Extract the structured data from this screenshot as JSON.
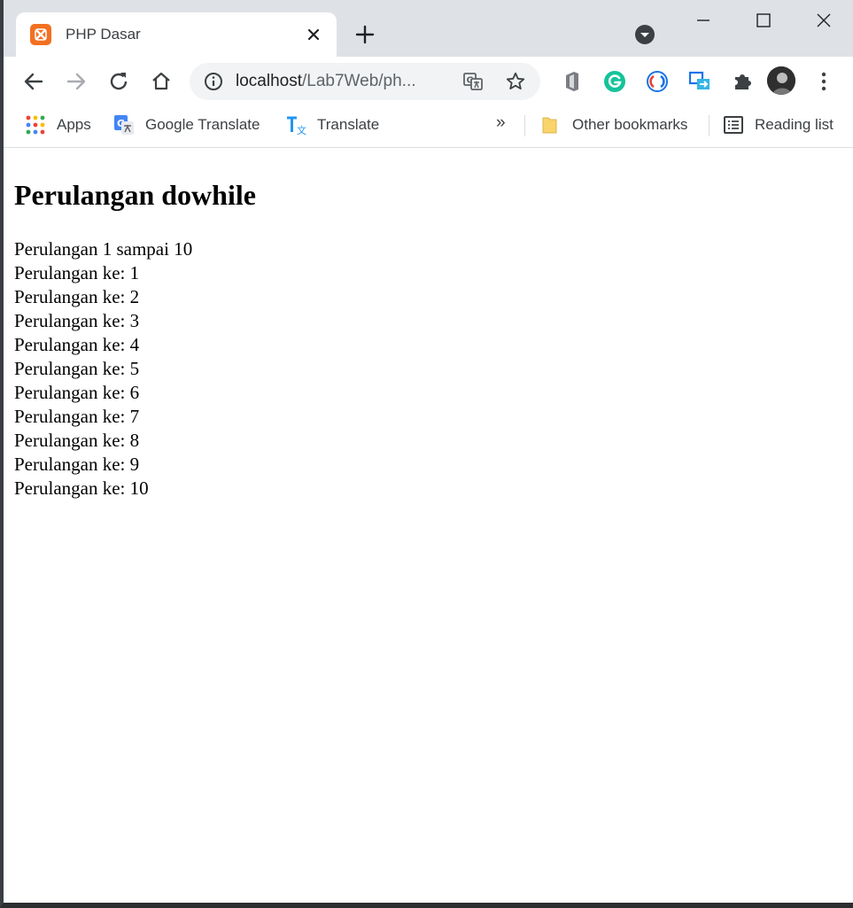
{
  "browser": {
    "tab": {
      "title": "PHP Dasar"
    },
    "address_bar": {
      "host": "localhost",
      "path": "/Lab7Web/ph..."
    },
    "bookmarks": [
      {
        "label": "Apps",
        "icon": "apps-grid-icon"
      },
      {
        "label": "Google Translate",
        "icon": "google-translate-icon"
      },
      {
        "label": "Translate",
        "icon": "translate-icon"
      }
    ],
    "bookmarks_overflow": "»",
    "other_bookmarks": "Other bookmarks",
    "reading_list": "Reading list",
    "extensions": [
      "office-icon",
      "grammarly-icon",
      "sync-icon",
      "cast-icon",
      "puzzle-icon"
    ]
  },
  "page": {
    "heading": "Perulangan dowhile",
    "intro": "Perulangan 1 sampai 10",
    "lines": [
      "Perulangan ke: 1",
      "Perulangan ke: 2",
      "Perulangan ke: 3",
      "Perulangan ke: 4",
      "Perulangan ke: 5",
      "Perulangan ke: 6",
      "Perulangan ke: 7",
      "Perulangan ke: 8",
      "Perulangan ke: 9",
      "Perulangan ke: 10"
    ]
  },
  "colors": {
    "tabstrip": "#dee1e6",
    "omnibox": "#f1f3f4",
    "favicon": "#f37021",
    "grammarly": "#15c39a",
    "folder": "#f9d36b"
  }
}
